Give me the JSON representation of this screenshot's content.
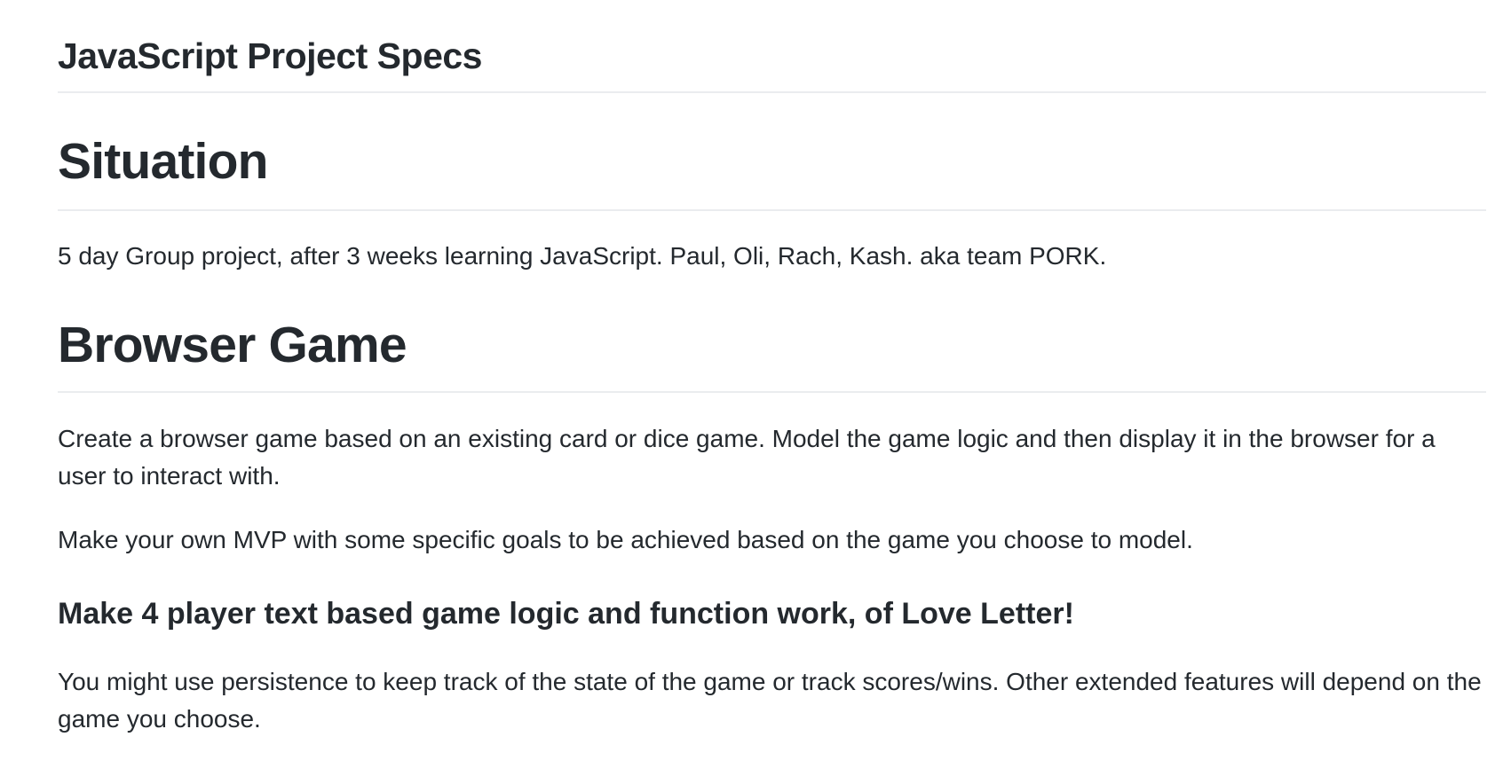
{
  "document": {
    "title": "JavaScript Project Specs",
    "sections": [
      {
        "heading": "Situation",
        "paragraphs": [
          "5 day Group project, after 3 weeks learning JavaScript. Paul, Oli, Rach, Kash. aka team PORK."
        ]
      },
      {
        "heading": "Browser Game",
        "paragraphs": [
          "Create a browser game based on an existing card or dice game. Model the game logic and then display it in the browser for a user to interact with.",
          "Make your own MVP with some specific goals to be achieved based on the game you choose to model."
        ],
        "subheading": "Make 4 player text based game logic and function work, of Love Letter!",
        "sub_paragraphs": [
          "You might use persistence to keep track of the state of the game or track scores/wins. Other extended features will depend on the game you choose."
        ]
      }
    ]
  }
}
